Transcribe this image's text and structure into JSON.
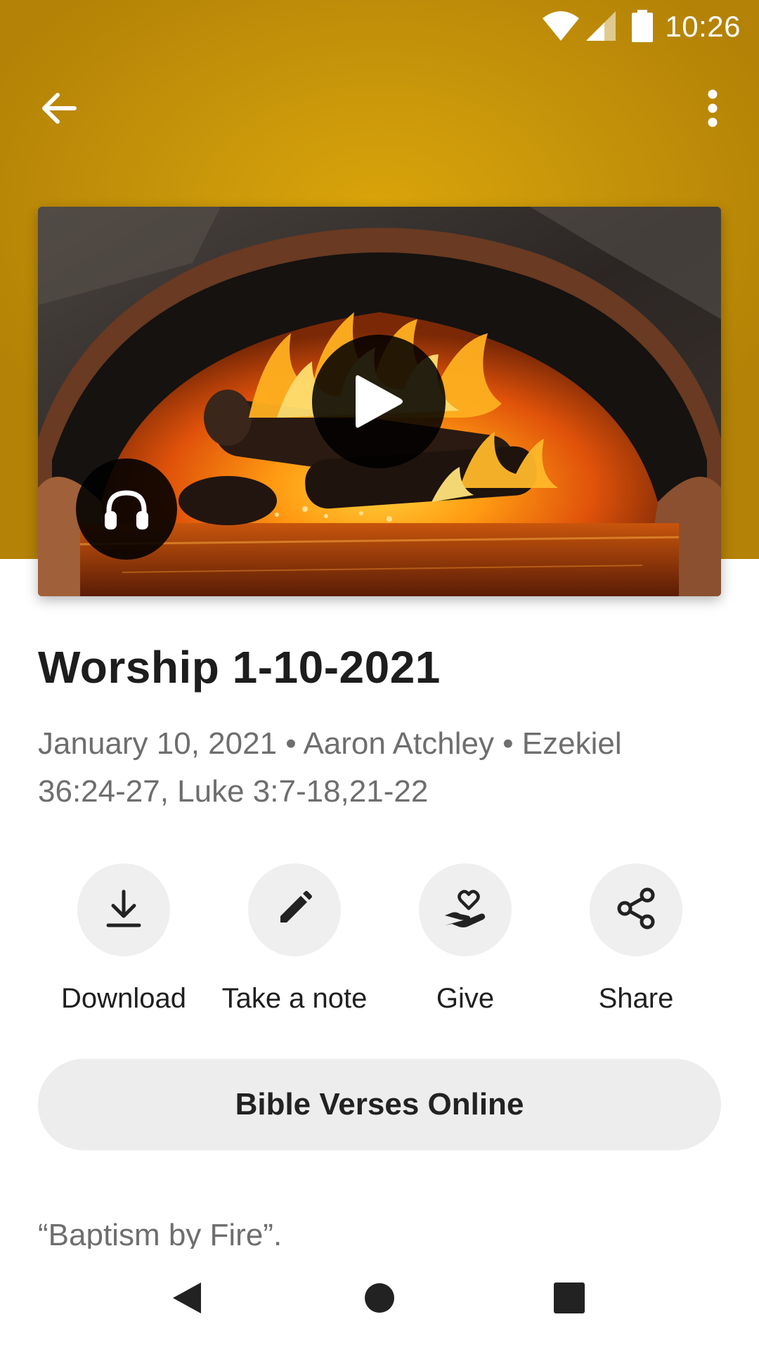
{
  "status_bar": {
    "time": "10:26",
    "icons": [
      "wifi-icon",
      "signal-icon",
      "battery-icon"
    ]
  },
  "toolbar": {
    "back_icon": "arrow-back-icon",
    "menu_icon": "more-vert-icon"
  },
  "media": {
    "image_subject": "fire-in-brick-oven",
    "play_icon": "play-icon",
    "audio_icon": "headphones-icon"
  },
  "sermon": {
    "title": "Worship 1-10-2021",
    "meta": "January 10, 2021 • Aaron Atchley • Ezekiel 36:24-27, Luke 3:7-18,21-22",
    "description": "“Baptism by Fire”."
  },
  "actions": [
    {
      "label": "Download",
      "icon": "download-icon"
    },
    {
      "label": "Take a note",
      "icon": "pencil-icon"
    },
    {
      "label": "Give",
      "icon": "give-heart-hand-icon"
    },
    {
      "label": "Share",
      "icon": "share-icon"
    }
  ],
  "verses_button": {
    "label": "Bible Verses Online"
  },
  "nav_bar": {
    "icons": [
      "nav-back-icon",
      "nav-home-icon",
      "nav-recents-icon"
    ]
  },
  "colors": {
    "header": "#c8960a",
    "action_circle": "#efefef",
    "title_text": "#1d1d1d",
    "meta_text": "#6e6e6e"
  }
}
